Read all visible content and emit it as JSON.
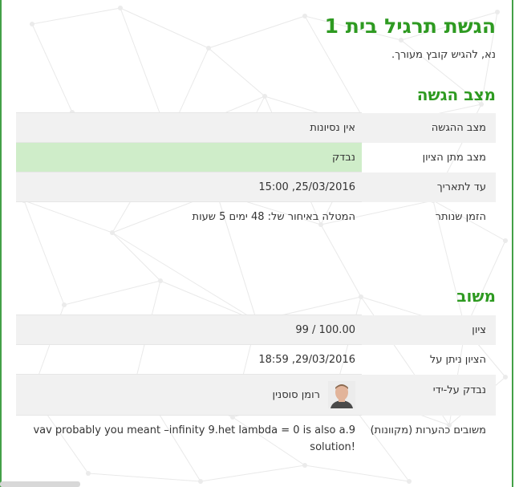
{
  "page": {
    "title": "הגשת תרגיל בית 1",
    "subtitle": "נא, להגיש קובץ מעורך."
  },
  "submission_status": {
    "heading": "מצב הגשה",
    "rows": [
      {
        "label": "מצב ההגשה",
        "value": "אין נסיונות"
      },
      {
        "label": "מצב מתן הציון",
        "value": "נבדק"
      },
      {
        "label": "עד לתאריך",
        "value": "25/03/2016, 15:00"
      },
      {
        "label": "הזמן שנותר",
        "value": "המטלה באיחור של: 48 ימים 5 שעות"
      }
    ]
  },
  "feedback": {
    "heading": "משוב",
    "rows": [
      {
        "label": "ציון",
        "value": "99 / 100.00"
      },
      {
        "label": "הציון ניתן על",
        "value": "29/03/2016, 18:59"
      },
      {
        "label": "נבדק על-ידי",
        "value": "רומן סוסנין"
      },
      {
        "label": "משובים כהערות (מקוונות)",
        "value": "vav probably you meant –infinity 9.het lambda = 0 is also a.9 solution!"
      }
    ]
  },
  "colors": {
    "accent": "#2e9a21",
    "graded_bg": "#cfedc9",
    "late_text": "#c42a1c",
    "frame": "#43a047"
  }
}
